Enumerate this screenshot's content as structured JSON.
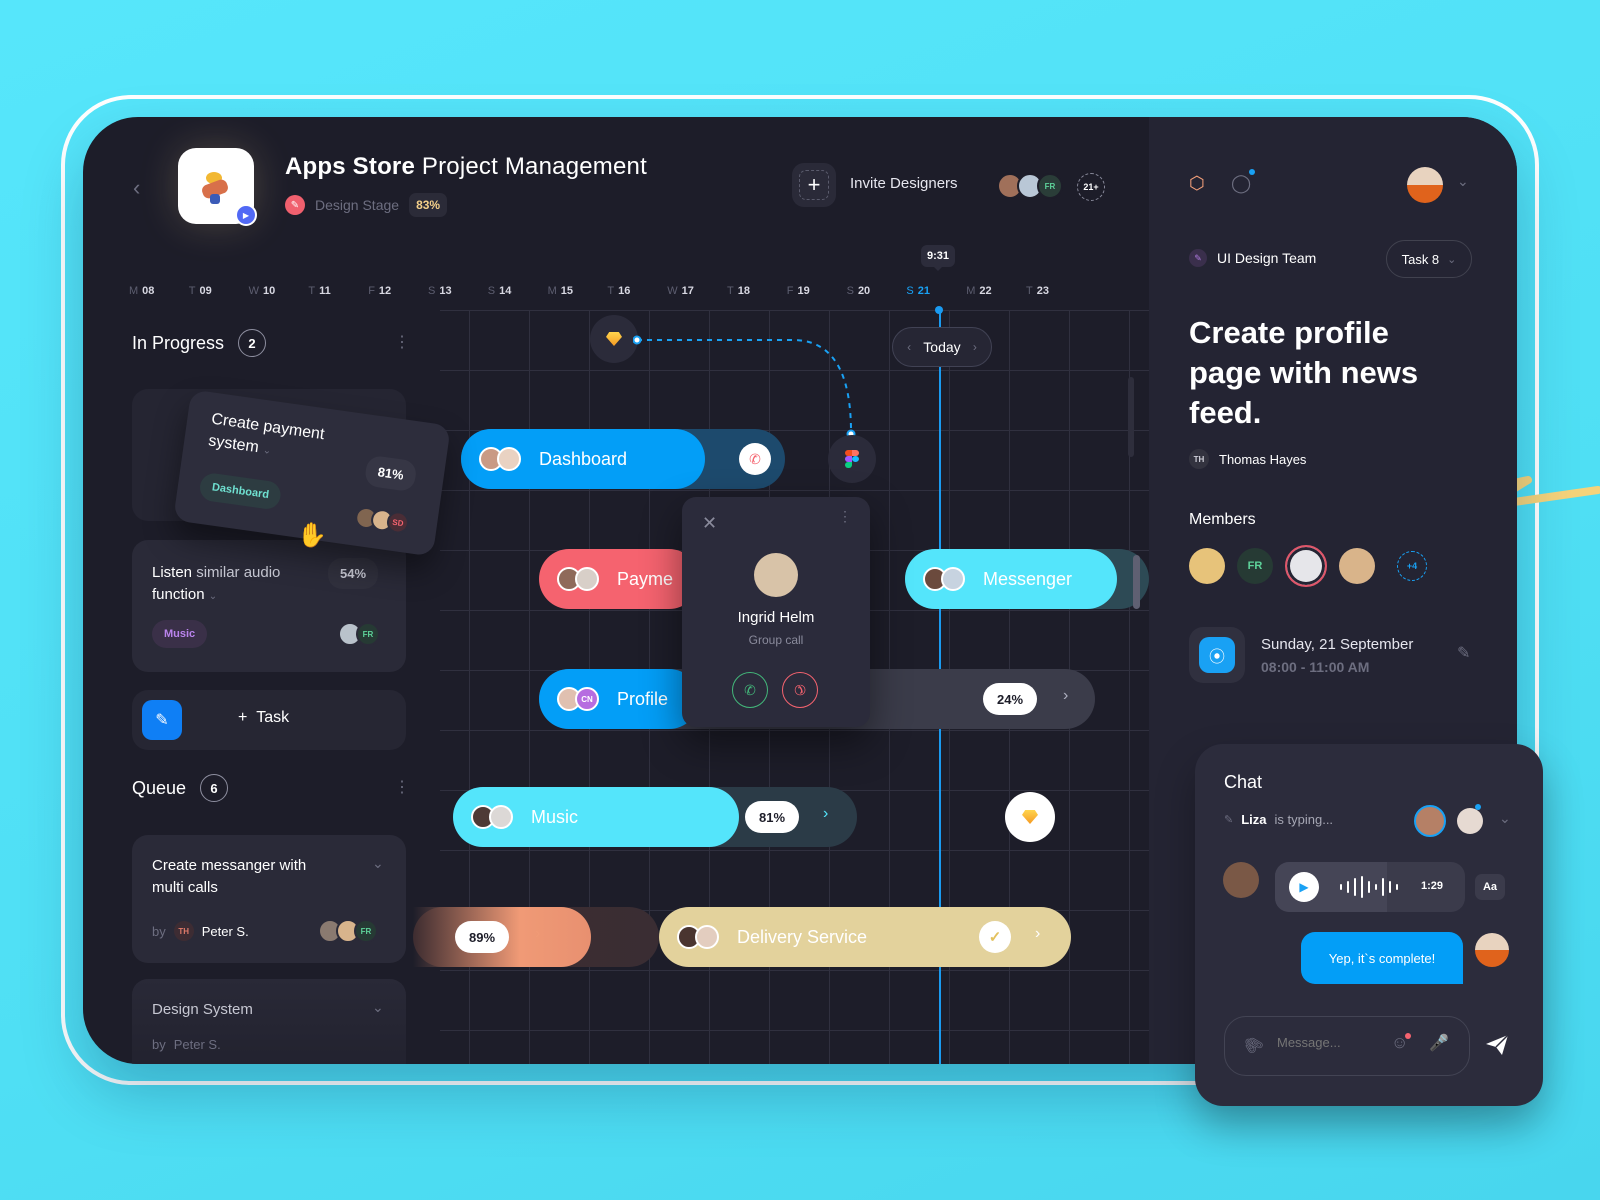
{
  "header": {
    "title_bold": "Apps Store",
    "title_rest": "Project Management",
    "stage_label": "Design Stage",
    "stage_percent": "83%",
    "invite_label": "Invite Designers",
    "invite_avatars": [
      {
        "initials": "",
        "color": "#a0705a"
      },
      {
        "initials": "",
        "color": "#b9c7d6"
      },
      {
        "initials": "FR",
        "color": "#2a3d38",
        "text": "#5ed39a"
      }
    ],
    "invite_more": "21+"
  },
  "timeline": {
    "dates": [
      {
        "dow": "M",
        "day": "08"
      },
      {
        "dow": "T",
        "day": "09"
      },
      {
        "dow": "W",
        "day": "10"
      },
      {
        "dow": "T",
        "day": "11"
      },
      {
        "dow": "F",
        "day": "12"
      },
      {
        "dow": "S",
        "day": "13"
      },
      {
        "dow": "S",
        "day": "14"
      },
      {
        "dow": "M",
        "day": "15"
      },
      {
        "dow": "T",
        "day": "16"
      },
      {
        "dow": "W",
        "day": "17"
      },
      {
        "dow": "T",
        "day": "18"
      },
      {
        "dow": "F",
        "day": "19"
      },
      {
        "dow": "S",
        "day": "20"
      },
      {
        "dow": "S",
        "day": "21",
        "today": true
      },
      {
        "dow": "M",
        "day": "22"
      },
      {
        "dow": "T",
        "day": "23"
      }
    ],
    "current_time": "9:31",
    "today_label": "Today",
    "bars": {
      "dashboard": {
        "label": "Dashboard",
        "color": "#039ef7"
      },
      "payment": {
        "label": "Payme",
        "color": "#f5636f"
      },
      "messenger": {
        "label": "Messenger",
        "color": "#54e5fb"
      },
      "profile": {
        "label": "Profile",
        "color": "#039ef7",
        "percent": "24%"
      },
      "music": {
        "label": "Music",
        "color": "#54e5fb",
        "percent": "81%"
      },
      "unnamed": {
        "percent": "89%",
        "color": "#f09a76"
      },
      "delivery": {
        "label": "Delivery Service",
        "color": "#e3d29c"
      }
    },
    "call_popup": {
      "name": "Ingrid Helm",
      "subtitle": "Group call"
    }
  },
  "in_progress": {
    "title": "In Progress",
    "count": "2",
    "cards": [
      {
        "title": "Create payment system",
        "percent": "81%",
        "tag": "Dashboard",
        "avatar_badge": "SD"
      },
      {
        "title_bold": "Listen",
        "title_rest": " similar audio",
        "title_line2": "function",
        "percent": "54%",
        "tag": "Music",
        "avatar_badge": "FR"
      }
    ],
    "add_task_label": "Task"
  },
  "queue": {
    "title": "Queue",
    "count": "6",
    "cards": [
      {
        "title": "Create messanger with multi calls",
        "by_label": "by",
        "author_initials": "TH",
        "author": "Peter S.",
        "avatar_badge": "FR"
      },
      {
        "title": "Design System",
        "by_label": "by",
        "author": "Peter S."
      }
    ]
  },
  "detail": {
    "team": "UI Design Team",
    "task_select": "Task 8",
    "title": "Create profile page with news feed.",
    "author_initials": "TH",
    "author": "Thomas Hayes",
    "members_label": "Members",
    "members_more": "+4",
    "member_initials": "FR",
    "date": "Sunday, 21 September",
    "time_range": "08:00 - 11:00 AM"
  },
  "chat": {
    "title": "Chat",
    "typing_name": "Liza",
    "typing_text": "is typing...",
    "voice_duration": "1:29",
    "font_button": "Aa",
    "sent_message": "Yep, it`s complete!",
    "input_placeholder": "Message..."
  },
  "colors": {
    "accent_blue": "#19a1f4",
    "accent_cyan": "#54e5fb",
    "accent_red": "#f5636f",
    "accent_sand": "#e3d29c",
    "panel_bg": "#1d1d29"
  }
}
